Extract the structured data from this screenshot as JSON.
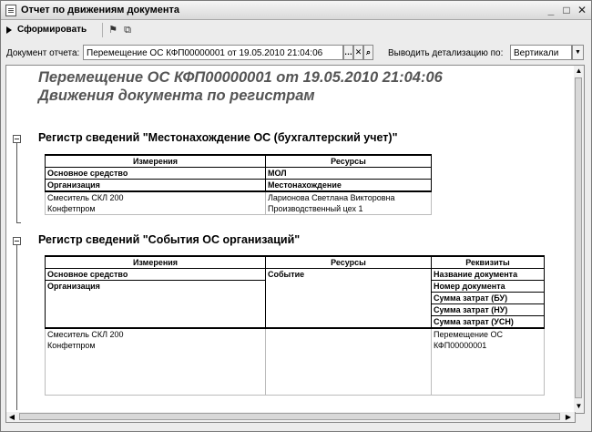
{
  "window": {
    "title": "Отчет по движениям документа"
  },
  "toolbar": {
    "generate_label": "Сформировать"
  },
  "params": {
    "document_label": "Документ отчета:",
    "document_value": "Перемещение ОС КФП00000001 от 19.05.2010 21:04:06",
    "detail_label": "Выводить детализацию по:",
    "detail_value": "Вертикали"
  },
  "report": {
    "title": "Перемещение ОС КФП00000001 от 19.05.2010 21:04:06",
    "subtitle": "Движения документа по регистрам",
    "register1": {
      "title": "Регистр сведений \"Местонахождение ОС (бухгалтерский учет)\"",
      "col_dimensions": "Измерения",
      "col_resources": "Ресурсы",
      "dim1": "Основное средство",
      "dim2": "Организация",
      "res1": "МОЛ",
      "res2": "Местонахождение",
      "row": {
        "asset": "Смеситель СКЛ 200",
        "org": "Конфетпром",
        "mol": "Ларионова Светлана Викторовна",
        "location": "Производственный цех 1"
      }
    },
    "register2": {
      "title": "Регистр сведений \"События ОС организаций\"",
      "col_dimensions": "Измерения",
      "col_resources": "Ресурсы",
      "col_attrs": "Реквизиты",
      "dim1": "Основное средство",
      "dim2": "Организация",
      "res1": "Событие",
      "attr1": "Название документа",
      "attr2": "Номер документа",
      "attr3": "Сумма затрат (БУ)",
      "attr4": "Сумма затрат (НУ)",
      "attr5": "Сумма затрат (УСН)",
      "row": {
        "asset": "Смеситель СКЛ 200",
        "org": "Конфетпром",
        "doc_name": "Перемещение ОС",
        "doc_number": "КФП00000001"
      }
    }
  },
  "icons": {
    "generate": "play-triangle-icon",
    "flag": "flag-icon",
    "copy": "copy-icon",
    "ellipsis": "ellipsis-icon",
    "clear": "clear-x-icon",
    "search": "magnifier-icon",
    "dropdown": "dropdown-arrow-icon",
    "collapse": "minus-box-icon"
  }
}
